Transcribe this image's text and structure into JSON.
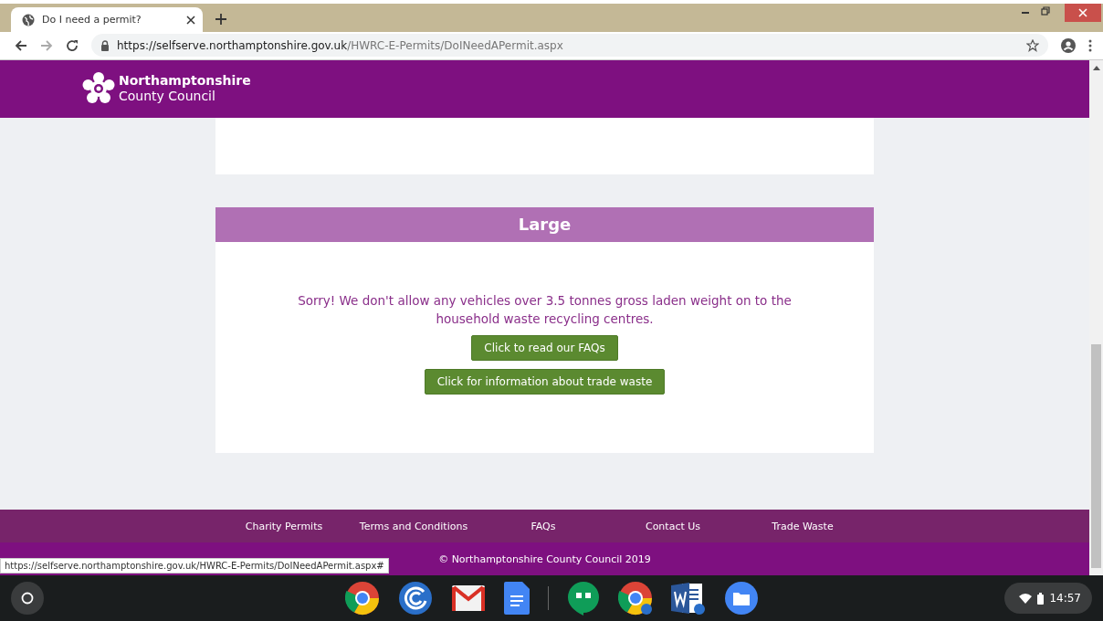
{
  "browser": {
    "tab": {
      "title": "Do I need a permit?",
      "selected": true
    },
    "url_host": "https://selfserve.northamptonshire.gov.uk",
    "url_path": "/HWRC-E-Permits/DoINeedAPermit.aspx",
    "status_url": "https://selfserve.northamptonshire.gov.uk/HWRC-E-Permits/DoINeedAPermit.aspx#"
  },
  "header": {
    "logo_line1": "Northamptonshire",
    "logo_line2": "County Council"
  },
  "section": {
    "title": "Large",
    "message": "Sorry! We don't allow any vehicles over 3.5 tonnes gross laden weight on to the household waste recycling centres.",
    "buttons": [
      "Click to read our FAQs",
      "Click for information about trade waste"
    ]
  },
  "footer": {
    "links": [
      "Charity Permits",
      "Terms and Conditions",
      "FAQs",
      "Contact Us",
      "Trade Waste"
    ],
    "copyright": "© Northamptonshire County Council 2019"
  },
  "taskbar": {
    "time": "14:57"
  }
}
